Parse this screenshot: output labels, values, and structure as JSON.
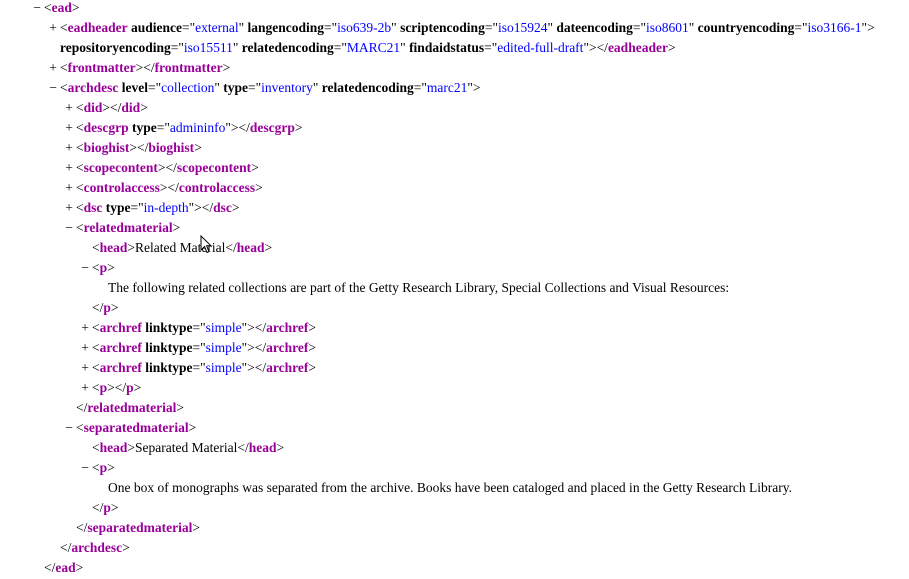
{
  "colors": {
    "tag": "#990099",
    "attribute_value": "#0000ff",
    "text": "#000000",
    "background": "#ffffff"
  },
  "lines": [
    {
      "indent": 0,
      "toggle": "−",
      "kind": "open",
      "tag": "ead",
      "attrs": []
    },
    {
      "indent": 1,
      "toggle": "+",
      "kind": "open",
      "tag": "eadheader",
      "attrs": [
        {
          "name": "audience",
          "value": "external"
        },
        {
          "name": "langencoding",
          "value": "iso639-2b"
        },
        {
          "name": "scriptencoding",
          "value": "iso15924"
        },
        {
          "name": "dateencoding",
          "value": "iso8601"
        },
        {
          "name": "countryencoding",
          "value": "iso3166-1"
        }
      ]
    },
    {
      "indent": 1,
      "toggle": "",
      "kind": "cont",
      "continuation": true,
      "attrs": [
        {
          "name": "repositoryencoding",
          "value": "iso15511"
        },
        {
          "name": "relatedencoding",
          "value": "MARC21"
        },
        {
          "name": "findaidstatus",
          "value": "edited-full-draft"
        }
      ],
      "closeTag": "eadheader"
    },
    {
      "indent": 1,
      "toggle": "+",
      "kind": "pair",
      "tag": "frontmatter",
      "attrs": []
    },
    {
      "indent": 1,
      "toggle": "−",
      "kind": "open",
      "tag": "archdesc",
      "attrs": [
        {
          "name": "level",
          "value": "collection"
        },
        {
          "name": "type",
          "value": "inventory"
        },
        {
          "name": "relatedencoding",
          "value": "marc21"
        }
      ]
    },
    {
      "indent": 2,
      "toggle": "+",
      "kind": "pair",
      "tag": "did",
      "attrs": []
    },
    {
      "indent": 2,
      "toggle": "+",
      "kind": "pair",
      "tag": "descgrp",
      "attrs": [
        {
          "name": "type",
          "value": "admininfo"
        }
      ]
    },
    {
      "indent": 2,
      "toggle": "+",
      "kind": "pair",
      "tag": "bioghist",
      "attrs": []
    },
    {
      "indent": 2,
      "toggle": "+",
      "kind": "pair",
      "tag": "scopecontent",
      "attrs": []
    },
    {
      "indent": 2,
      "toggle": "+",
      "kind": "pair",
      "tag": "controlaccess",
      "attrs": []
    },
    {
      "indent": 2,
      "toggle": "+",
      "kind": "pair",
      "tag": "dsc",
      "attrs": [
        {
          "name": "type",
          "value": "in-depth"
        }
      ]
    },
    {
      "indent": 2,
      "toggle": "−",
      "kind": "open",
      "tag": "relatedmaterial",
      "attrs": []
    },
    {
      "indent": 3,
      "toggle": "",
      "kind": "inline",
      "tag": "head",
      "text": "Related Material"
    },
    {
      "indent": 3,
      "toggle": "−",
      "kind": "open",
      "tag": "p",
      "attrs": []
    },
    {
      "indent": 4,
      "toggle": "",
      "kind": "text",
      "text": "The following related collections are part of the Getty Research Library, Special Collections and Visual Resources:"
    },
    {
      "indent": 3,
      "toggle": "",
      "kind": "close",
      "tag": "p"
    },
    {
      "indent": 3,
      "toggle": "+",
      "kind": "pair",
      "tag": "archref",
      "attrs": [
        {
          "name": "linktype",
          "value": "simple"
        }
      ]
    },
    {
      "indent": 3,
      "toggle": "+",
      "kind": "pair",
      "tag": "archref",
      "attrs": [
        {
          "name": "linktype",
          "value": "simple"
        }
      ]
    },
    {
      "indent": 3,
      "toggle": "+",
      "kind": "pair",
      "tag": "archref",
      "attrs": [
        {
          "name": "linktype",
          "value": "simple"
        }
      ]
    },
    {
      "indent": 3,
      "toggle": "+",
      "kind": "pair",
      "tag": "p",
      "attrs": []
    },
    {
      "indent": 2,
      "toggle": "",
      "kind": "close",
      "tag": "relatedmaterial"
    },
    {
      "indent": 2,
      "toggle": "−",
      "kind": "open",
      "tag": "separatedmaterial",
      "attrs": []
    },
    {
      "indent": 3,
      "toggle": "",
      "kind": "inline",
      "tag": "head",
      "text": "Separated Material"
    },
    {
      "indent": 3,
      "toggle": "−",
      "kind": "open",
      "tag": "p",
      "attrs": []
    },
    {
      "indent": 4,
      "toggle": "",
      "kind": "text",
      "text": "One box of monographs was separated from the archive. Books have been cataloged and placed in the Getty Research Library."
    },
    {
      "indent": 3,
      "toggle": "",
      "kind": "close",
      "tag": "p"
    },
    {
      "indent": 2,
      "toggle": "",
      "kind": "close",
      "tag": "separatedmaterial"
    },
    {
      "indent": 1,
      "toggle": "",
      "kind": "close",
      "tag": "archdesc"
    },
    {
      "indent": 0,
      "toggle": "",
      "kind": "close",
      "tag": "ead"
    }
  ]
}
